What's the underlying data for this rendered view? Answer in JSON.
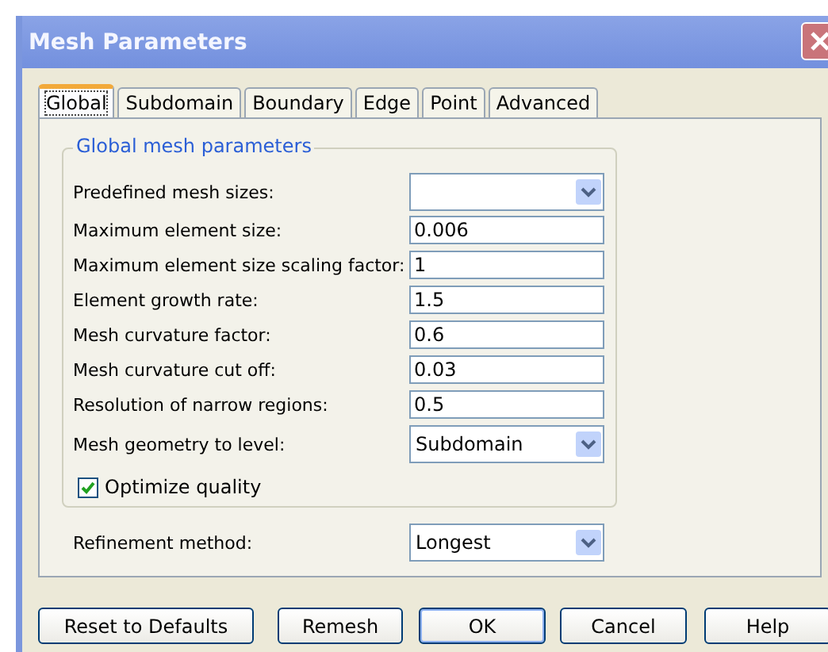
{
  "window": {
    "title": "Mesh Parameters"
  },
  "tabs": [
    {
      "label": "Global",
      "selected": true
    },
    {
      "label": "Subdomain",
      "selected": false
    },
    {
      "label": "Boundary",
      "selected": false
    },
    {
      "label": "Edge",
      "selected": false
    },
    {
      "label": "Point",
      "selected": false
    },
    {
      "label": "Advanced",
      "selected": false
    }
  ],
  "group": {
    "title": "Global mesh parameters",
    "rows": [
      {
        "kind": "combo",
        "label": "Predefined mesh sizes:"
      },
      {
        "kind": "text",
        "label": "Maximum element size:",
        "value": "0.006"
      },
      {
        "kind": "text",
        "label": "Maximum element size scaling factor:",
        "value": "1"
      },
      {
        "kind": "text",
        "label": "Element growth rate:",
        "value": "1.5"
      },
      {
        "kind": "text",
        "label": "Mesh curvature factor:",
        "value": "0.6"
      },
      {
        "kind": "text",
        "label": "Mesh curvature cut off:",
        "value": "0.03"
      },
      {
        "kind": "text",
        "label": "Resolution of narrow regions:",
        "value": "0.5"
      },
      {
        "kind": "combo",
        "label": "Mesh geometry to level:",
        "value": "Subdomain"
      }
    ],
    "checkbox": {
      "label": "Optimize quality",
      "checked": true
    }
  },
  "refinement": {
    "kind": "combo",
    "label": "Refinement method:",
    "value": "Longest"
  },
  "buttons": [
    {
      "label": "Reset to Defaults",
      "default": false
    },
    {
      "label": "Remesh",
      "default": false
    },
    {
      "label": "OK",
      "default": true
    },
    {
      "label": "Cancel",
      "default": false
    },
    {
      "label": "Help",
      "default": false
    }
  ]
}
